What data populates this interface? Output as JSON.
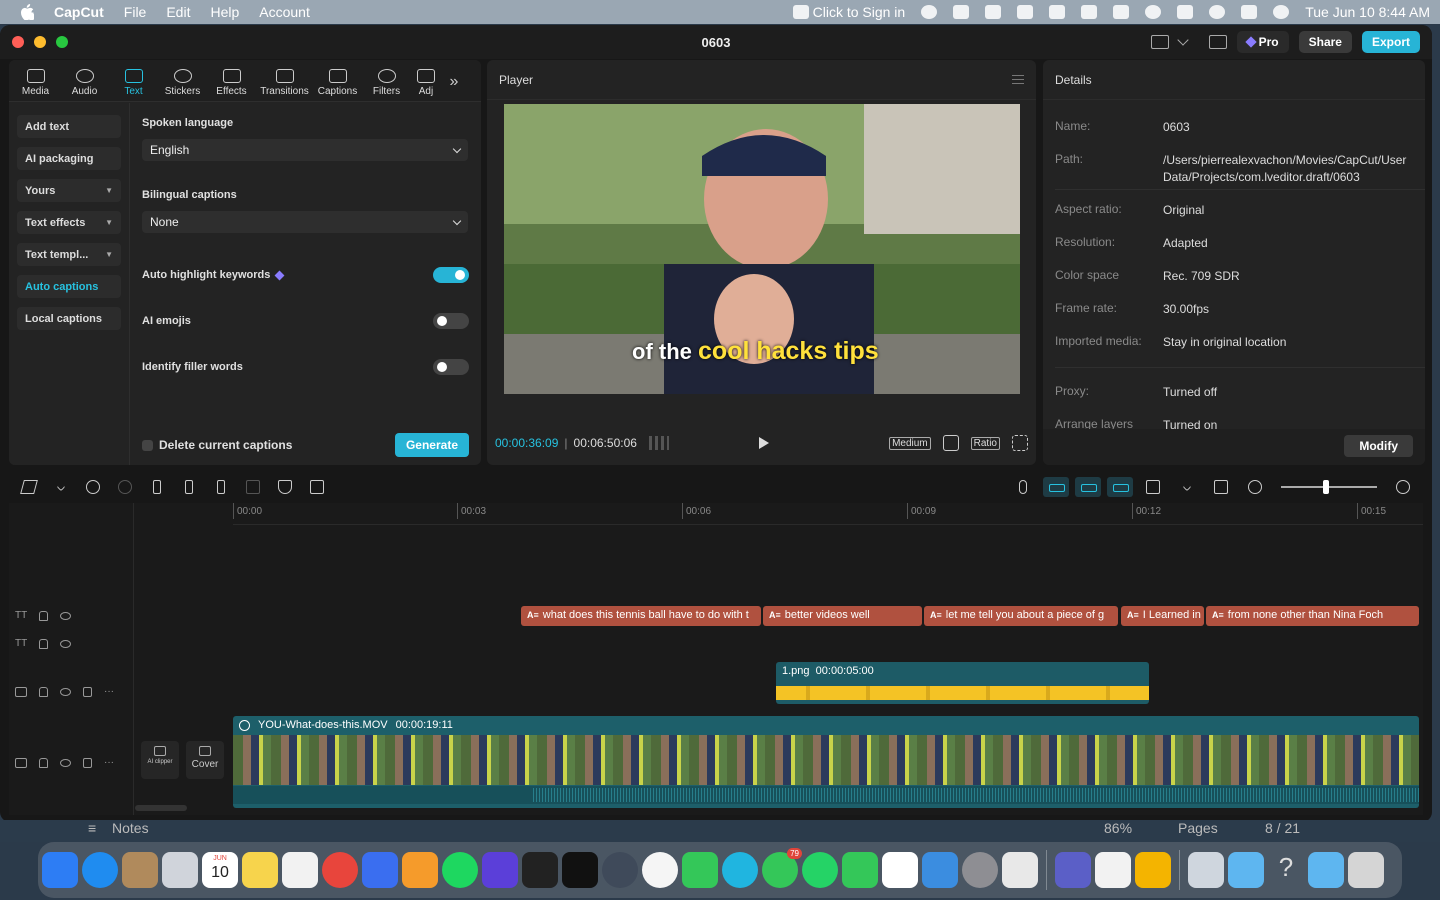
{
  "menubar": {
    "app": "CapCut",
    "items": [
      "File",
      "Edit",
      "Help",
      "Account"
    ],
    "sign_in": "Click to Sign in",
    "datetime": "Tue Jun 10  8:44 AM"
  },
  "window": {
    "title": "0603",
    "pro_label": "Pro",
    "share_label": "Share",
    "export_label": "Export"
  },
  "left_panel": {
    "tabs": [
      {
        "label": "Media",
        "icon": "media-icon"
      },
      {
        "label": "Audio",
        "icon": "audio-icon"
      },
      {
        "label": "Text",
        "icon": "text-icon"
      },
      {
        "label": "Stickers",
        "icon": "stickers-icon"
      },
      {
        "label": "Effects",
        "icon": "effects-icon"
      },
      {
        "label": "Transitions",
        "icon": "transitions-icon"
      },
      {
        "label": "Captions",
        "icon": "captions-icon"
      },
      {
        "label": "Filters",
        "icon": "filters-icon"
      },
      {
        "label": "Adj",
        "icon": "adjust-icon"
      }
    ],
    "active_tab": "Text",
    "side_menu": [
      {
        "label": "Add text"
      },
      {
        "label": "AI packaging"
      },
      {
        "label": "Yours"
      },
      {
        "label": "Text effects"
      },
      {
        "label": "Text templ..."
      },
      {
        "label": "Auto captions"
      },
      {
        "label": "Local captions"
      }
    ],
    "active_side": "Auto captions",
    "spoken_language_label": "Spoken language",
    "spoken_language_value": "English",
    "bilingual_label": "Bilingual captions",
    "bilingual_value": "None",
    "auto_highlight_label": "Auto highlight keywords",
    "auto_highlight_on": true,
    "ai_emojis_label": "AI emojis",
    "ai_emojis_on": false,
    "filler_label": "Identify filler words",
    "filler_on": false,
    "delete_label": "Delete current captions",
    "generate_label": "Generate"
  },
  "player": {
    "header": "Player",
    "caption_plain": "of the",
    "caption_highlight": "cool hacks tips",
    "current_time": "00:00:36:09",
    "total_time": "00:06:50:06",
    "quality": "Medium",
    "ratio": "Ratio"
  },
  "details": {
    "header": "Details",
    "rows": [
      {
        "key": "Name:",
        "value": "0603"
      },
      {
        "key": "Path:",
        "value": "/Users/pierrealexvachon/Movies/CapCut/User Data/Projects/com.lveditor.draft/0603"
      },
      {
        "key": "Aspect ratio:",
        "value": "Original"
      },
      {
        "key": "Resolution:",
        "value": "Adapted"
      },
      {
        "key": "Color space",
        "value": "Rec. 709 SDR"
      },
      {
        "key": "Frame rate:",
        "value": "30.00fps"
      },
      {
        "key": "Imported media:",
        "value": "Stay in original location"
      },
      {
        "key": "Proxy:",
        "value": "Turned off"
      },
      {
        "key": "Arrange layers",
        "value": "Turned on"
      }
    ],
    "modify_label": "Modify"
  },
  "timeline": {
    "ruler": [
      "00:00",
      "00:03",
      "00:06",
      "00:09",
      "00:12",
      "00:15"
    ],
    "caption_clips": [
      {
        "text": "what does this tennis ball have to do with t"
      },
      {
        "text": "better videos well"
      },
      {
        "text": "let me tell you about a piece of g"
      },
      {
        "text": "I Learned in"
      },
      {
        "text": "from none other than Nina Foch"
      }
    ],
    "image_clip": {
      "name": "1.png",
      "duration": "00:00:05:00"
    },
    "main_clip": {
      "name": "YOU-What-does-this.MOV",
      "duration": "00:00:19:11"
    },
    "zoom_level": 0.47,
    "ai_clipper_label": "AI clipper",
    "cover_label": "Cover"
  },
  "background_app": {
    "notes_label": "Notes",
    "zoom": "86%",
    "pages_label": "Pages",
    "page_count": "8 / 21"
  },
  "dock": {
    "calendar_month": "JUN",
    "calendar_day": "10",
    "messages_badge": "79",
    "apps": [
      "finder",
      "safari",
      "contacts",
      "launchpad",
      "calendar",
      "notes",
      "freeform",
      "chrome",
      "docs",
      "pages",
      "spotify",
      "vpn",
      "robinhood",
      "capcut",
      "quicktime",
      "photos",
      "facetime-alt",
      "canva",
      "messages",
      "whatsapp",
      "facetime",
      "numbers",
      "keynote",
      "system-settings",
      "pdf-tool",
      "teams",
      "textedit",
      "slides",
      "scanner",
      "folder",
      "help",
      "folder-2",
      "trash"
    ]
  }
}
